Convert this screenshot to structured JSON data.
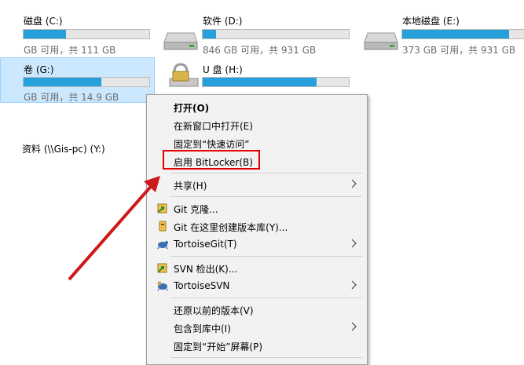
{
  "drives": [
    {
      "id": "c",
      "name": "磁盘 (C:)",
      "info": "GB 可用，共 111 GB",
      "used_fraction": 0.34
    },
    {
      "id": "d",
      "name": "软件 (D:)",
      "info": "846 GB 可用，共 931 GB",
      "used_fraction": 0.09
    },
    {
      "id": "e",
      "name": "本地磁盘 (E:)",
      "info": "373 GB 可用，共 931 GB",
      "used_fraction": 0.86
    },
    {
      "id": "g",
      "name": "卷 (G:)",
      "info": "GB 可用，共 14.9 GB",
      "used_fraction": 0.62
    },
    {
      "id": "h",
      "name": "U 盘 (H:)",
      "info": "",
      "used_fraction": 0.78
    }
  ],
  "network": {
    "label": "资料 (\\\\Gis-pc) (Y:)"
  },
  "watermark": "",
  "menu": {
    "items": [
      {
        "label": "打开(O)",
        "bold": true,
        "icon": "",
        "submenu": false
      },
      {
        "label": "在新窗口中打开(E)",
        "icon": "",
        "submenu": false
      },
      {
        "label": "固定到“快速访问”",
        "icon": "",
        "submenu": false
      },
      {
        "label": "启用 BitLocker(B)",
        "icon": "",
        "submenu": false,
        "highlighted": true
      },
      {
        "label": "共享(H)",
        "icon": "",
        "submenu": true
      },
      {
        "label": "Git 克隆...",
        "icon": "git-clone-icon",
        "submenu": false
      },
      {
        "label": "Git 在这里创建版本库(Y)...",
        "icon": "git-create-repo-icon",
        "submenu": false
      },
      {
        "label": "TortoiseGit(T)",
        "icon": "tortoisegit-icon",
        "submenu": true
      },
      {
        "label": "SVN 检出(K)...",
        "icon": "svn-checkout-icon",
        "submenu": false
      },
      {
        "label": "TortoiseSVN",
        "icon": "tortoisesvn-icon",
        "submenu": true
      },
      {
        "label": "还原以前的版本(V)",
        "icon": "",
        "submenu": false
      },
      {
        "label": "包含到库中(I)",
        "icon": "",
        "submenu": true
      },
      {
        "label": "固定到“开始”屏幕(P)",
        "icon": "",
        "submenu": false
      }
    ]
  },
  "colors": {
    "accent": "#26a0da",
    "highlight_box": "#e00000",
    "arrow": "#cc1a1a",
    "selected_tile": "#cce8ff"
  }
}
